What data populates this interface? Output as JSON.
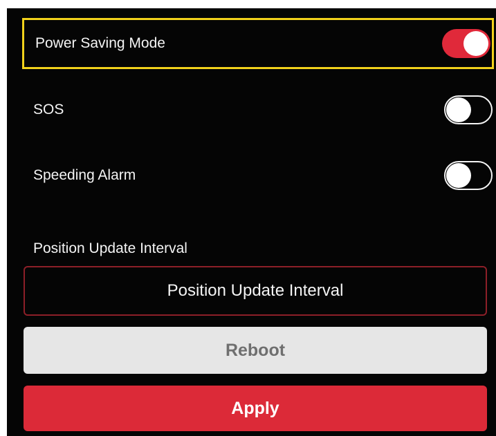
{
  "settings": {
    "power_saving": {
      "label": "Power Saving Mode",
      "enabled": true,
      "focused": true
    },
    "sos": {
      "label": "SOS",
      "enabled": false
    },
    "speeding_alarm": {
      "label": "Speeding Alarm",
      "enabled": false
    }
  },
  "position_update": {
    "section_label": "Position Update Interval",
    "button_label": "Position Update Interval"
  },
  "actions": {
    "reboot_label": "Reboot",
    "apply_label": "Apply"
  },
  "colors": {
    "background": "#050505",
    "accent": "#dc2a38",
    "focus": "#f2d21b",
    "toggle_on": "#e0293a"
  }
}
